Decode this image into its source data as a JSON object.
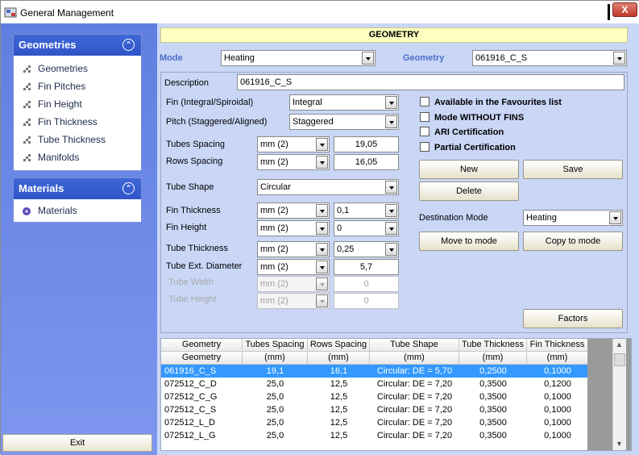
{
  "window": {
    "title": "General Management",
    "close_label": "X"
  },
  "sidebar": {
    "geometries_panel": {
      "title": "Geometries",
      "items": [
        {
          "label": "Geometries"
        },
        {
          "label": "Fin Pitches"
        },
        {
          "label": "Fin Height"
        },
        {
          "label": "Fin Thickness"
        },
        {
          "label": "Tube Thickness"
        },
        {
          "label": "Manifolds"
        }
      ]
    },
    "materials_panel": {
      "title": "Materials",
      "items": [
        {
          "label": "Materials"
        }
      ]
    },
    "exit_label": "Exit"
  },
  "header": {
    "title": "GEOMETRY",
    "mode_label": "Mode",
    "mode_value": "Heating",
    "geometry_label": "Geometry",
    "geometry_value": "061916_C_S"
  },
  "form": {
    "description_label": "Description",
    "description_value": "061916_C_S",
    "fin_label": "Fin (Integral/Spiroidal)",
    "fin_value": "Integral",
    "pitch_label": "Pitch (Staggered/Aligned)",
    "pitch_value": "Staggered",
    "tubes_spacing_label": "Tubes Spacing",
    "tubes_spacing_unit": "mm (2)",
    "tubes_spacing_value": "19,05",
    "rows_spacing_label": "Rows Spacing",
    "rows_spacing_unit": "mm (2)",
    "rows_spacing_value": "16,05",
    "tube_shape_label": "Tube Shape",
    "tube_shape_value": "Circular",
    "fin_thickness_label": "Fin Thickness",
    "fin_thickness_unit": "mm (2)",
    "fin_thickness_value": "0,1",
    "fin_height_label": "Fin Height",
    "fin_height_unit": "mm (2)",
    "fin_height_value": "0",
    "tube_thickness_label": "Tube Thickness",
    "tube_thickness_unit": "mm (2)",
    "tube_thickness_value": "0,25",
    "tube_ext_diameter_label": "Tube Ext. Diameter",
    "tube_ext_diameter_unit": "mm (2)",
    "tube_ext_diameter_value": "5,7",
    "tube_width_label": "Tube Width",
    "tube_width_unit": "mm (2)",
    "tube_width_value": "0",
    "tube_height_label": "Tube Height",
    "tube_height_unit": "mm (2)",
    "tube_height_value": "0",
    "checkboxes": [
      {
        "label": "Available in the Favourites list",
        "checked": false
      },
      {
        "label": "Mode WITHOUT FINS",
        "checked": false
      },
      {
        "label": "ARI Certification",
        "checked": false
      },
      {
        "label": "Partial Certification",
        "checked": false
      }
    ],
    "new_label": "New",
    "save_label": "Save",
    "delete_label": "Delete",
    "destination_mode_label": "Destination Mode",
    "destination_mode_value": "Heating",
    "move_to_mode_label": "Move to mode",
    "copy_to_mode_label": "Copy to mode",
    "factors_label": "Factors"
  },
  "table": {
    "headers": [
      [
        "Geometry",
        "Geometry"
      ],
      [
        "Tubes Spacing",
        "(mm)"
      ],
      [
        "Rows Spacing",
        "(mm)"
      ],
      [
        "Tube Shape",
        "(mm)"
      ],
      [
        "Tube Thickness",
        "(mm)"
      ],
      [
        "Fin Thickness",
        "(mm)"
      ]
    ],
    "rows": [
      [
        "061916_C_S",
        "19,1",
        "16,1",
        "Circular: DE = 5,70",
        "0,2500",
        "0,1000"
      ],
      [
        "072512_C_D",
        "25,0",
        "12,5",
        "Circular: DE = 7,20",
        "0,3500",
        "0,1200"
      ],
      [
        "072512_C_G",
        "25,0",
        "12,5",
        "Circular: DE = 7,20",
        "0,3500",
        "0,1000"
      ],
      [
        "072512_C_S",
        "25,0",
        "12,5",
        "Circular: DE = 7,20",
        "0,3500",
        "0,1000"
      ],
      [
        "072512_L_D",
        "25,0",
        "12,5",
        "Circular: DE = 7,20",
        "0,3500",
        "0,1000"
      ],
      [
        "072512_L_G",
        "25,0",
        "12,5",
        "Circular: DE = 7,20",
        "0,3500",
        "0,1000"
      ]
    ],
    "selected_row": 0
  }
}
